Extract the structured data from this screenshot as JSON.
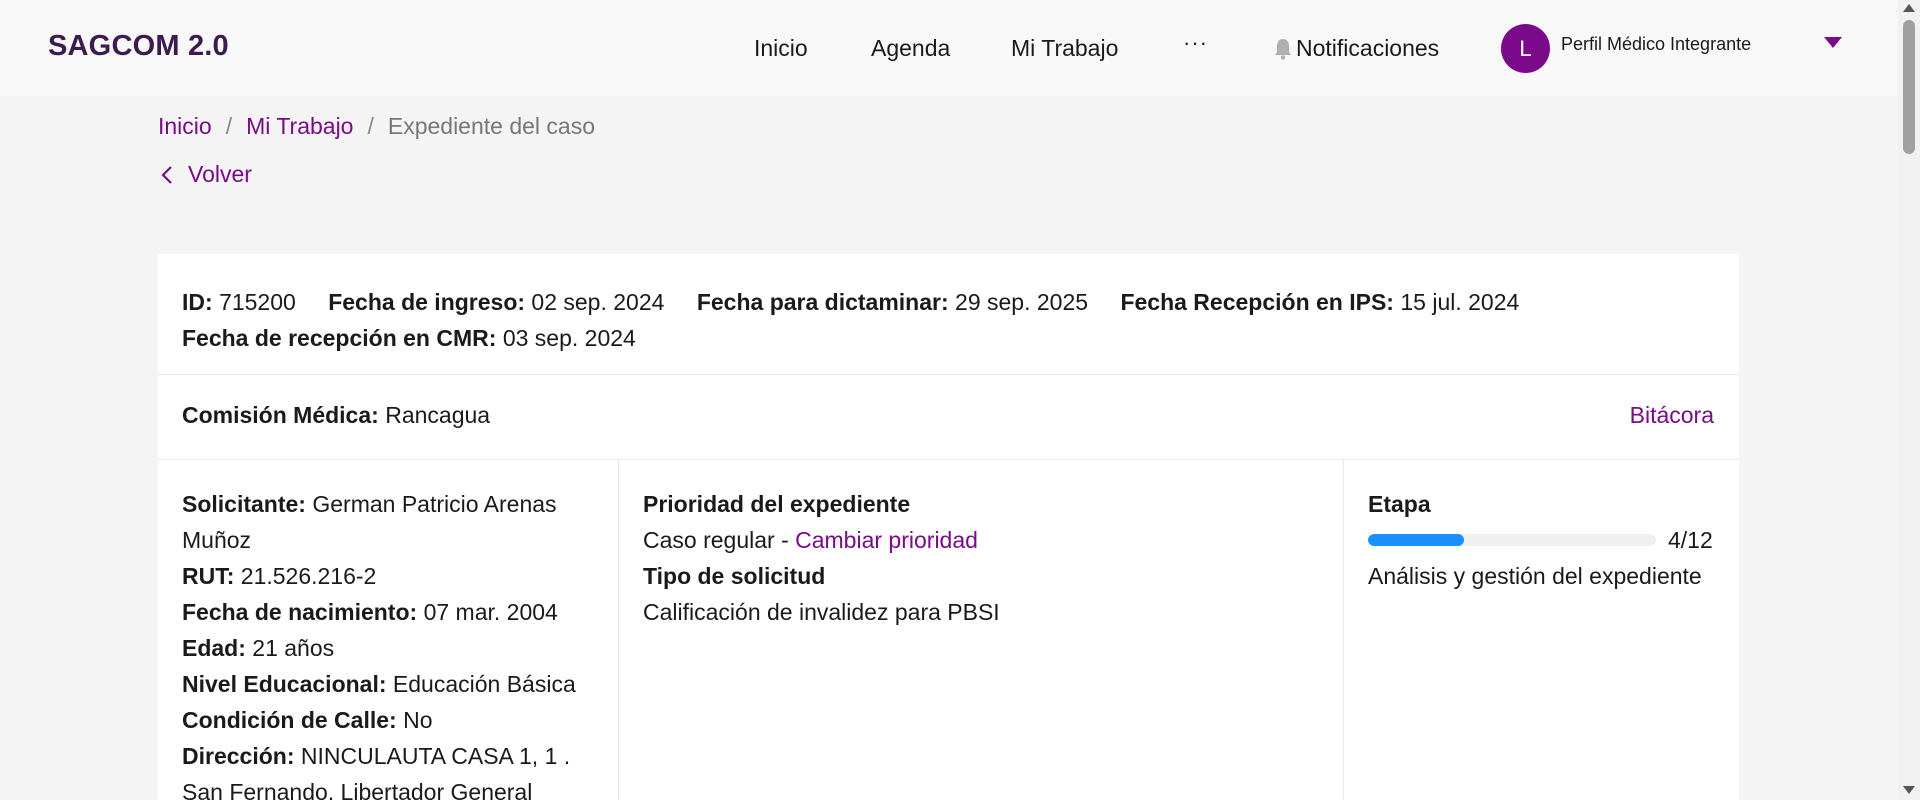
{
  "header": {
    "brand": "SAGCOM 2.0",
    "nav": {
      "inicio": "Inicio",
      "agenda": "Agenda",
      "mi_trabajo": "Mi Trabajo",
      "more": "···",
      "notificaciones": "Notificaciones"
    },
    "avatar_initial": "L",
    "profile_name": "Perfil Médico Integrante",
    "bell_icon": "bell-icon",
    "caret_icon": "caret-down-icon"
  },
  "breadcrumb": {
    "items": [
      "Inicio",
      "Mi Trabajo"
    ],
    "separator": "/",
    "current": "Expediente del caso"
  },
  "back_label": "Volver",
  "case": {
    "id_label": "ID:",
    "id": "715200",
    "fecha_ingreso_label": "Fecha de ingreso:",
    "fecha_ingreso": "02 sep. 2024",
    "fecha_dictaminar_label": "Fecha para dictaminar:",
    "fecha_dictaminar": "29 sep. 2025",
    "fecha_ips_label": "Fecha Recepción en IPS:",
    "fecha_ips": "15 jul. 2024",
    "fecha_cmr_label": "Fecha de recepción en CMR:",
    "fecha_cmr": "03 sep. 2024",
    "comision_label": "Comisión Médica:",
    "comision": "Rancagua",
    "bitacora": "Bitácora"
  },
  "solicitante": {
    "nombre_label": "Solicitante:",
    "nombre": "German Patricio Arenas Muñoz",
    "rut_label": "RUT:",
    "rut": "21.526.216-2",
    "nacimiento_label": "Fecha de nacimiento:",
    "nacimiento": "07 mar. 2004",
    "edad_label": "Edad:",
    "edad": "21 años",
    "nivel_label": "Nivel Educacional:",
    "nivel": "Educación Básica",
    "calle_label": "Condición de Calle:",
    "calle": "No",
    "direccion_label": "Dirección:",
    "direccion": "NINCULAUTA CASA 1, 1 . San Fernando, Libertador General"
  },
  "expediente": {
    "prioridad_label": "Prioridad del expediente",
    "prioridad": "Caso regular - ",
    "cambiar_prioridad": "Cambiar prioridad",
    "tipo_label": "Tipo de solicitud",
    "tipo": "Calificación de invalidez para PBSI"
  },
  "etapa": {
    "label": "Etapa",
    "progress_text": "4/12",
    "progress_fraction": 0.3333,
    "progress_color": "#1890ff",
    "descripcion": "Análisis y gestión del expediente"
  },
  "colors": {
    "accent": "#7a0a8a",
    "brand": "#3d1a4f"
  }
}
